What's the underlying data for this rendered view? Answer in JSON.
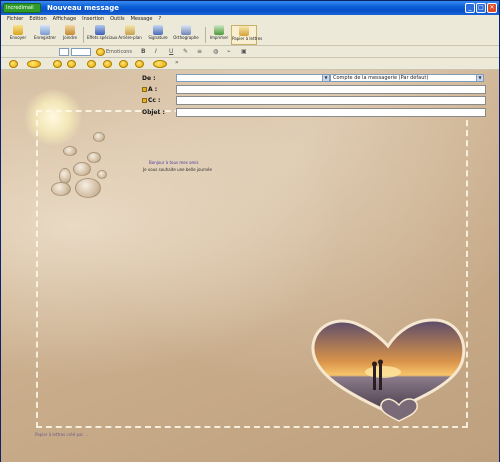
{
  "window": {
    "app_badge": "Incredimail",
    "title": "Nouveau message",
    "controls": {
      "minimize": "_",
      "maximize": "□",
      "close": "✕"
    }
  },
  "menu": {
    "items": [
      "Fichier",
      "Edition",
      "Affichage",
      "Insertion",
      "Outils",
      "Message",
      "?"
    ]
  },
  "toolbar": {
    "send_label": "Envoyer",
    "save_label": "Enregistrer",
    "cut_label": "Joindre",
    "attach_label": "Effets spéciaux",
    "background_label": "Arrière-plan",
    "signature_label": "Signature",
    "spell_label": "Orthographe",
    "options_label": "Imprimer",
    "stationery_label": "Papier à lettres",
    "icons": {
      "send": "send-icon",
      "save": "save-icon",
      "attach": "attach-icon",
      "effects": "effects-icon",
      "background": "background-icon",
      "signature": "signature-icon",
      "spell": "spell-icon",
      "print": "print-icon",
      "stationery": "stationery-icon"
    }
  },
  "format_bar": {
    "font_size": "",
    "emoticons_label": "Emoticons",
    "bold": "B",
    "italic": "I",
    "underline": "U"
  },
  "headers": {
    "from_label": "De :",
    "to_label": "A :",
    "cc_label": "Cc :",
    "subject_label": "Objet :",
    "account_value": "Compte de la messagerie (Par défaut)",
    "to_value": "",
    "cc_value": "",
    "subject_value": ""
  },
  "body": {
    "greeting_line1": "Bonjour à tous mes amis",
    "greeting_line2": "Je vous souhaite une belle journée",
    "footer_note": "Papier à lettres créé par ..."
  },
  "colors": {
    "titlebar": "#0a5fd8",
    "stationery_base": "#cdb291",
    "frame": "#fffaeb"
  }
}
